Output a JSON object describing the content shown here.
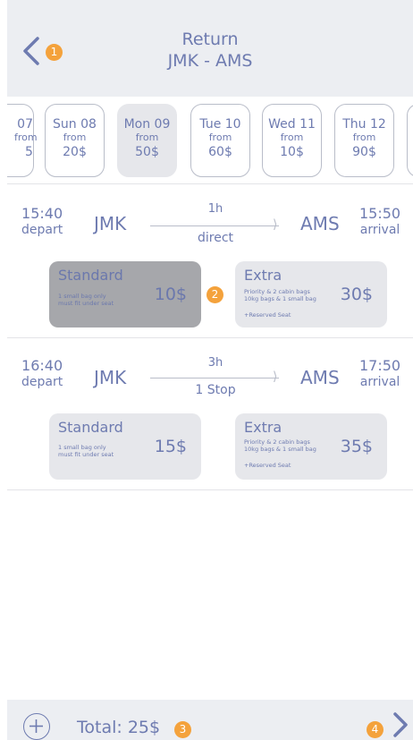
{
  "header": {
    "title": "Return",
    "route": "JMK - AMS",
    "back_badge": "1"
  },
  "dates": [
    {
      "day": "07",
      "from": "from",
      "price": "5"
    },
    {
      "day": "Sun 08",
      "from": "from",
      "price": "20$"
    },
    {
      "day": "Mon 09",
      "from": "from",
      "price": "50$",
      "selected": true
    },
    {
      "day": "Tue 10",
      "from": "from",
      "price": "60$"
    },
    {
      "day": "Wed 11",
      "from": "from",
      "price": "10$"
    },
    {
      "day": "Thu 12",
      "from": "from",
      "price": "90$"
    }
  ],
  "flights": [
    {
      "depart_time": "15:40",
      "depart_label": "depart",
      "origin": "JMK",
      "duration": "1h",
      "stops": "direct",
      "destination": "AMS",
      "arrival_time": "15:50",
      "arrival_label": "arrival",
      "fares": {
        "standard": {
          "name": "Standard",
          "desc1": "1 small bag only",
          "desc2": "must fit under seat",
          "price": "10$",
          "badge": "2"
        },
        "extra": {
          "name": "Extra",
          "desc1": "Priority & 2 cabin bags",
          "desc2": "10kg bags & 1 small bag",
          "desc3": "+Reserved Seat",
          "price": "30$"
        }
      }
    },
    {
      "depart_time": "16:40",
      "depart_label": "depart",
      "origin": "JMK",
      "duration": "3h",
      "stops": "1 Stop",
      "destination": "AMS",
      "arrival_time": "17:50",
      "arrival_label": "arrival",
      "fares": {
        "standard": {
          "name": "Standard",
          "desc1": "1 small bag only",
          "desc2": "must fit under seat",
          "price": "15$"
        },
        "extra": {
          "name": "Extra",
          "desc1": "Priority & 2 cabin bags",
          "desc2": "10kg bags & 1 small bag",
          "desc3": "+Reserved Seat",
          "price": "35$"
        }
      }
    }
  ],
  "footer": {
    "total_label": "Total: 25$",
    "total_badge": "3",
    "next_badge": "4"
  },
  "colors": {
    "accent": "#6e7bb0",
    "badge": "#f4a23c",
    "header_bg": "#eceef2",
    "selected_fare": "#a6a7ab"
  }
}
